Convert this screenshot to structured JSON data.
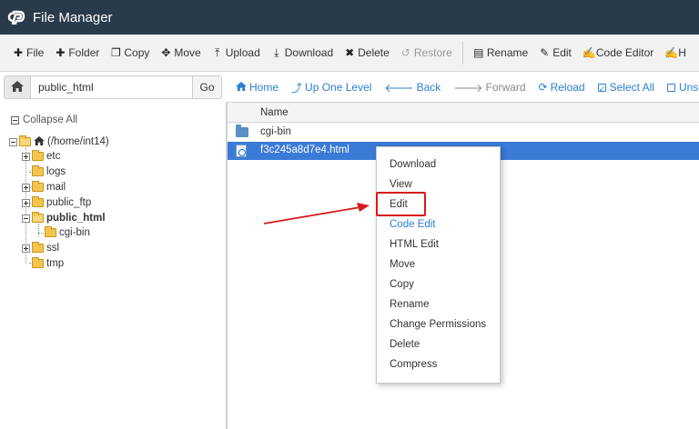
{
  "app": {
    "title": "File Manager"
  },
  "toolbar": {
    "items": [
      {
        "label": "File",
        "icon": "plus-icon"
      },
      {
        "label": "Folder",
        "icon": "plus-icon"
      },
      {
        "label": "Copy",
        "icon": "copy-icon"
      },
      {
        "label": "Move",
        "icon": "move-icon"
      },
      {
        "label": "Upload",
        "icon": "upload-icon"
      },
      {
        "label": "Download",
        "icon": "download-icon"
      },
      {
        "label": "Delete",
        "icon": "delete-icon"
      },
      {
        "label": "Restore",
        "icon": "restore-icon",
        "disabled": true
      },
      {
        "label": "Rename",
        "icon": "rename-icon"
      },
      {
        "label": "Edit",
        "icon": "edit-icon"
      },
      {
        "label": "Code Editor",
        "icon": "code-editor-icon"
      },
      {
        "label": "H",
        "icon": "html-editor-icon"
      }
    ]
  },
  "path_bar": {
    "value": "public_html",
    "go_label": "Go"
  },
  "sidebar": {
    "collapse_all_label": "Collapse All",
    "tree": [
      {
        "label": "(/home/int14)",
        "icon": "home-icon"
      },
      {
        "label": "etc"
      },
      {
        "label": "logs"
      },
      {
        "label": "mail"
      },
      {
        "label": "public_ftp"
      },
      {
        "label": "public_html",
        "bold": true
      },
      {
        "label": "cgi-bin"
      },
      {
        "label": "ssl"
      },
      {
        "label": "tmp"
      }
    ]
  },
  "navbar": {
    "home": "Home",
    "up_one_level": "Up One Level",
    "back": "Back",
    "forward": "Forward",
    "reload": "Reload",
    "select_all": "Select All",
    "unselect_all": "Unselect All"
  },
  "file_list": {
    "column_name": "Name",
    "rows": [
      {
        "name": "cgi-bin",
        "type": "folder"
      },
      {
        "name": "f3c245a8d7e4.html",
        "type": "html",
        "selected": true
      }
    ]
  },
  "context_menu": {
    "items": [
      "Download",
      "View",
      "Edit",
      "Code Edit",
      "HTML Edit",
      "Move",
      "Copy",
      "Rename",
      "Change Permissions",
      "Delete",
      "Compress"
    ],
    "highlighted": "Edit"
  },
  "colors": {
    "topbar": "#293a4a",
    "selection": "#3b7bd8",
    "link": "#2a7fd1",
    "highlight_box": "#d6191c"
  }
}
